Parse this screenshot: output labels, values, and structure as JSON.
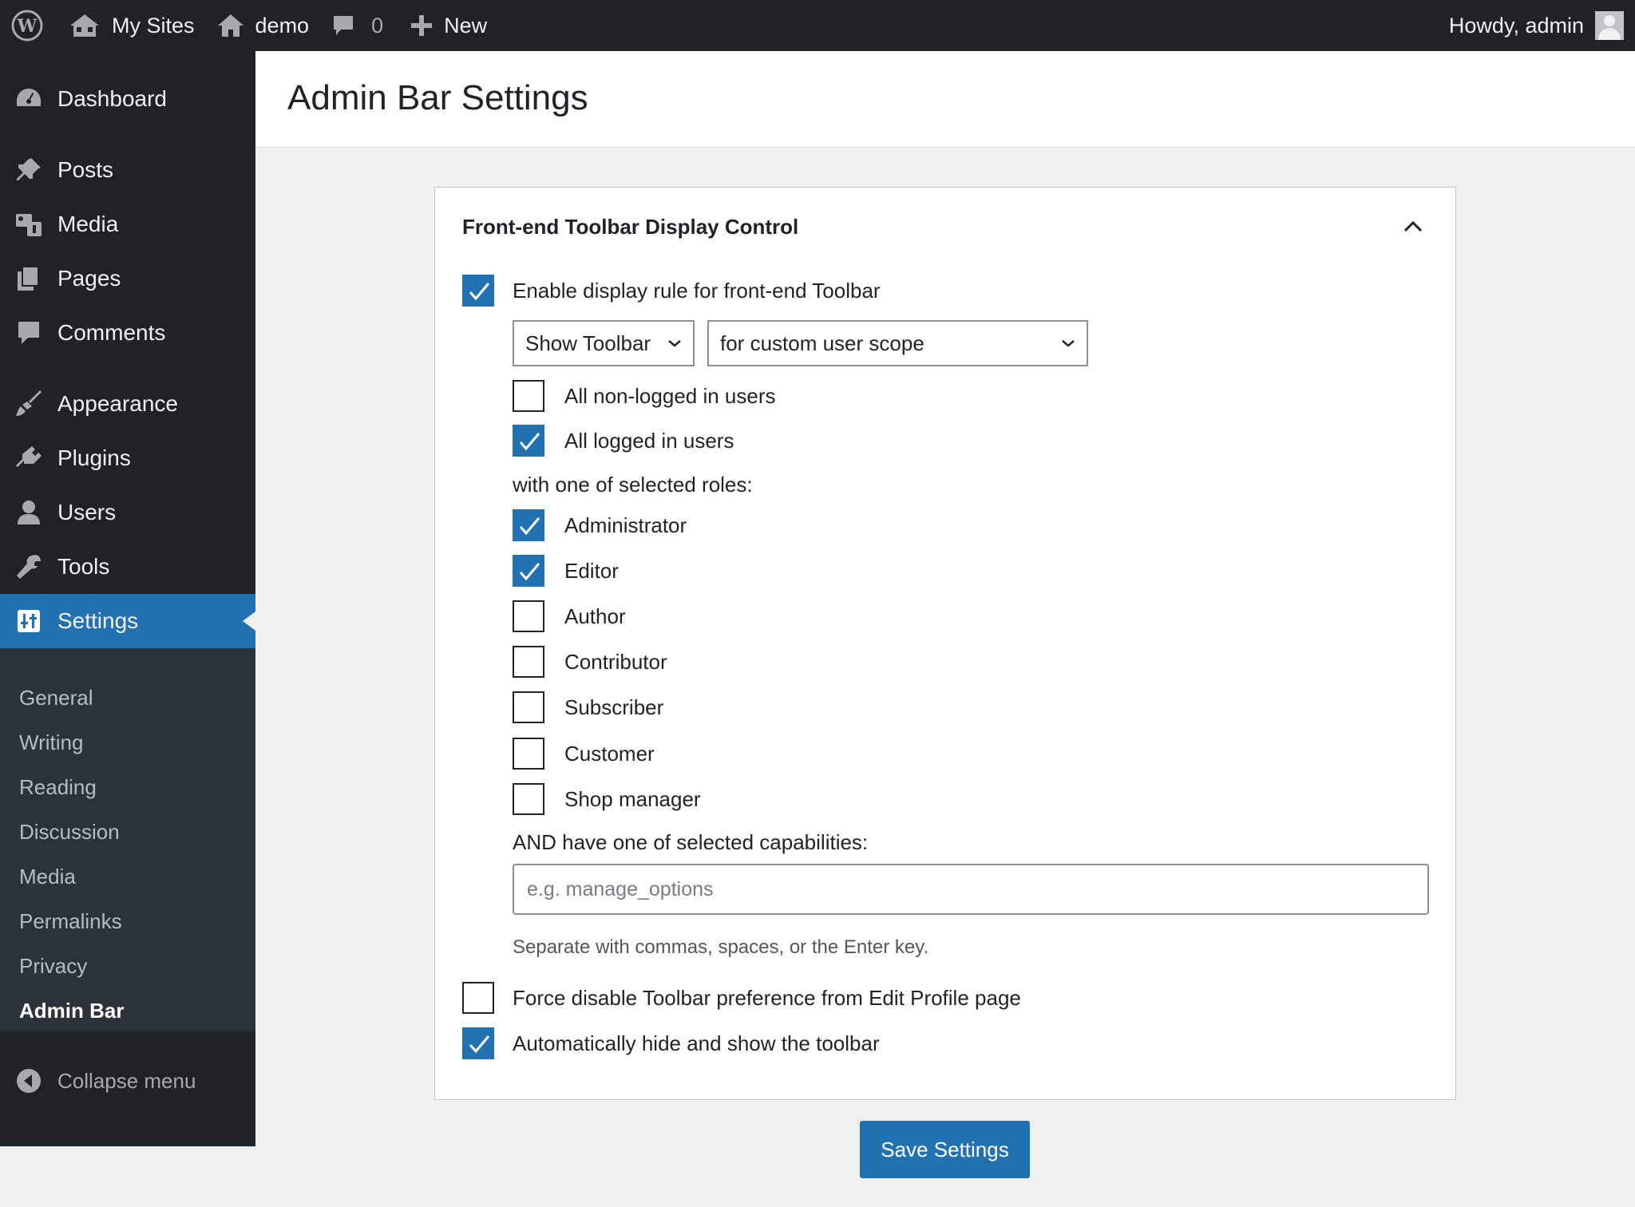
{
  "adminbar": {
    "my_sites": "My Sites",
    "site_name": "demo",
    "comments_count": "0",
    "new_label": "New",
    "greeting": "Howdy, admin"
  },
  "sidebar": {
    "items": [
      {
        "label": "Dashboard",
        "icon": "dashboard-icon"
      },
      {
        "label": "Posts",
        "icon": "pin-icon"
      },
      {
        "label": "Media",
        "icon": "media-icon"
      },
      {
        "label": "Pages",
        "icon": "pages-icon"
      },
      {
        "label": "Comments",
        "icon": "comment-icon"
      },
      {
        "label": "Appearance",
        "icon": "brush-icon"
      },
      {
        "label": "Plugins",
        "icon": "plugin-icon"
      },
      {
        "label": "Users",
        "icon": "user-icon"
      },
      {
        "label": "Tools",
        "icon": "wrench-icon"
      },
      {
        "label": "Settings",
        "icon": "settings-icon"
      }
    ],
    "submenu": [
      "General",
      "Writing",
      "Reading",
      "Discussion",
      "Media",
      "Permalinks",
      "Privacy",
      "Admin Bar"
    ],
    "collapse": "Collapse menu"
  },
  "page": {
    "title": "Admin Bar Settings"
  },
  "panel": {
    "title": "Front-end Toolbar Display Control",
    "enable_label": "Enable display rule for front-end Toolbar",
    "enable_checked": true,
    "action_select": "Show Toolbar",
    "scope_select": "for custom user scope",
    "non_logged_label": "All non-logged in users",
    "non_logged_checked": false,
    "logged_label": "All logged in users",
    "logged_checked": true,
    "roles_heading": "with one of selected roles:",
    "roles": [
      {
        "label": "Administrator",
        "checked": true
      },
      {
        "label": "Editor",
        "checked": true
      },
      {
        "label": "Author",
        "checked": false
      },
      {
        "label": "Contributor",
        "checked": false
      },
      {
        "label": "Subscriber",
        "checked": false
      },
      {
        "label": "Customer",
        "checked": false
      },
      {
        "label": "Shop manager",
        "checked": false
      }
    ],
    "capabilities_heading": "AND have one of selected capabilities:",
    "capabilities_placeholder": "e.g. manage_options",
    "capabilities_value": "",
    "capabilities_hint": "Separate with commas, spaces, or the Enter key.",
    "force_disable_label": "Force disable Toolbar preference from Edit Profile page",
    "force_disable_checked": false,
    "auto_hide_label": "Automatically hide and show the toolbar",
    "auto_hide_checked": true
  },
  "save_button": "Save Settings",
  "colors": {
    "accent": "#2271b1",
    "sidebar_bg": "#1d2327",
    "submenu_bg": "#2c3338",
    "page_bg": "#f0f0f1"
  }
}
